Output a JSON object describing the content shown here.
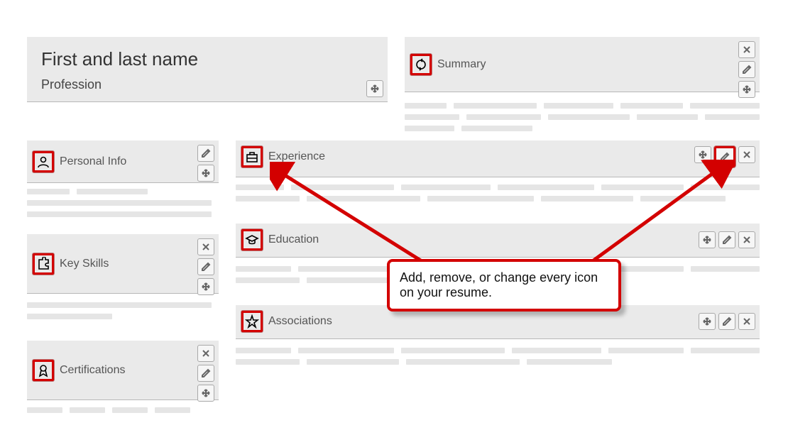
{
  "name_block": {
    "title": "First and last name",
    "subtitle": "Profession"
  },
  "sections": {
    "summary": "Summary",
    "personal_info": "Personal Info",
    "key_skills": "Key Skills",
    "certifications": "Certifications",
    "experience": "Experience",
    "education": "Education",
    "associations": "Associations"
  },
  "callout": "Add, remove, or change every icon on your resume."
}
